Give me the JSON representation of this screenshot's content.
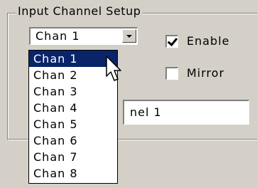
{
  "group": {
    "title": "Input Channel Setup"
  },
  "combo": {
    "value": "Chan 1"
  },
  "enable": {
    "label": "Enable",
    "checked": true
  },
  "mirror": {
    "label": "Mirror",
    "checked": false
  },
  "name_field": {
    "value": "nel 1"
  },
  "dropdown": {
    "items": [
      "Chan 1",
      "Chan 2",
      "Chan 3",
      "Chan 4",
      "Chan 5",
      "Chan 6",
      "Chan 7",
      "Chan 8"
    ],
    "selected_index": 0
  }
}
